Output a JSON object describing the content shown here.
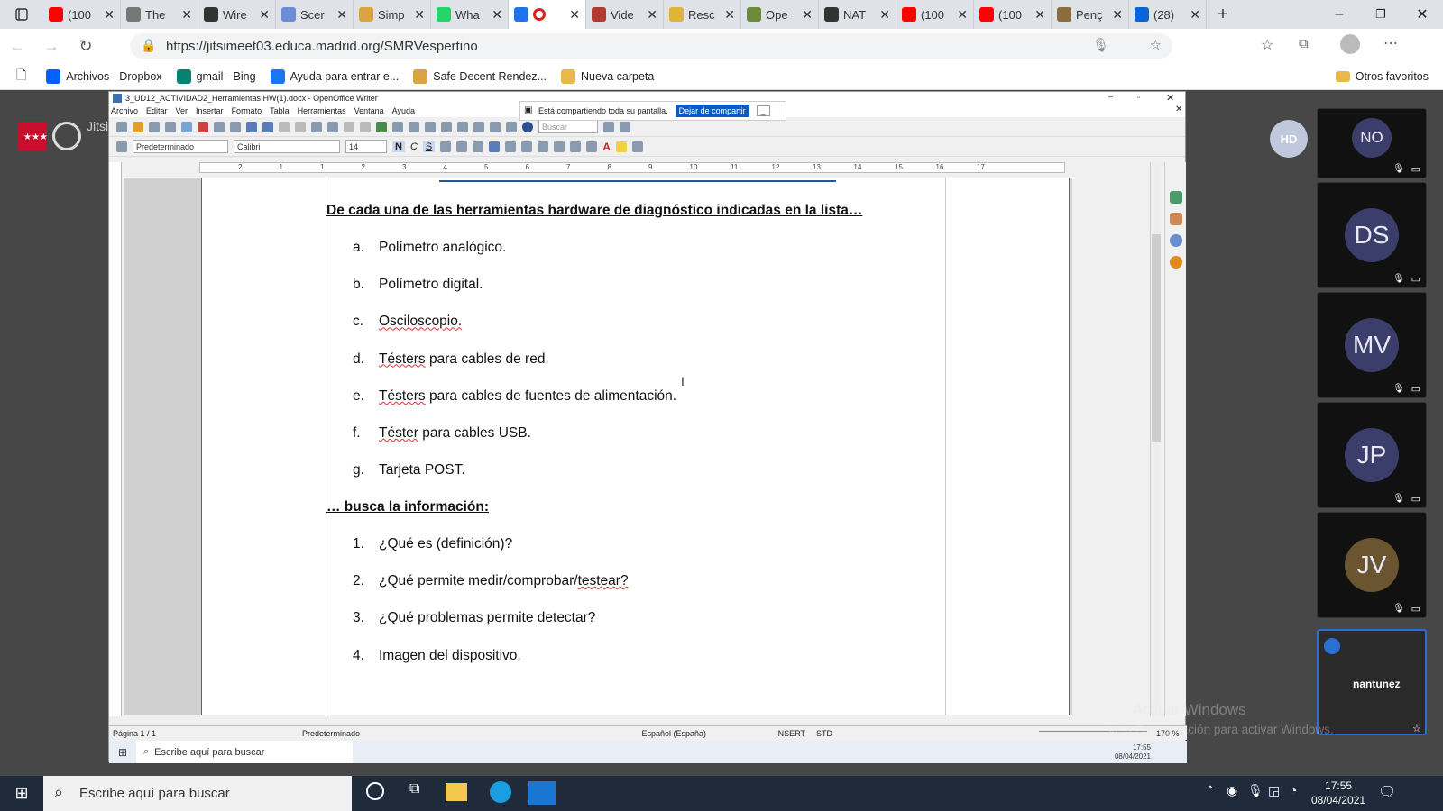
{
  "browser": {
    "tabs": [
      {
        "title": "(100",
        "icon": "youtube-icon",
        "color": "#ff0000"
      },
      {
        "title": "The",
        "icon": "medium-icon",
        "color": "#777777"
      },
      {
        "title": "Wire",
        "icon": "github-icon",
        "color": "#333333"
      },
      {
        "title": "Scer",
        "icon": "globe-icon",
        "color": "#6b8dd6"
      },
      {
        "title": "Simp",
        "icon": "hand-icon",
        "color": "#d9a441"
      },
      {
        "title": "Wha",
        "icon": "whatsapp-icon",
        "color": "#25d366"
      },
      {
        "title": "",
        "icon": "jitsi-icon",
        "color": "#1e73e8",
        "active": true
      },
      {
        "title": "Vide",
        "icon": "video-icon",
        "color": "#b03a2e"
      },
      {
        "title": "Resc",
        "icon": "smiley-icon",
        "color": "#e2b33b"
      },
      {
        "title": "Ope",
        "icon": "image-icon",
        "color": "#6d8a3a"
      },
      {
        "title": "NAT",
        "icon": "github-icon",
        "color": "#333333"
      },
      {
        "title": "(100",
        "icon": "youtube-icon",
        "color": "#ff0000"
      },
      {
        "title": "(100",
        "icon": "youtube-icon",
        "color": "#ff0000"
      },
      {
        "title": "Penç",
        "icon": "box-icon",
        "color": "#8a6d3b"
      },
      {
        "title": "(28)",
        "icon": "mail-icon",
        "color": "#0a64d8"
      }
    ],
    "url": "https://jitsimeet03.educa.madrid.org/SMRVespertino",
    "favorites": [
      {
        "label": "Archivos - Dropbox",
        "icon": "dropbox-icon"
      },
      {
        "label": "gmail - Bing",
        "icon": "bing-icon"
      },
      {
        "label": "Ayuda para entrar e...",
        "icon": "facebook-icon"
      },
      {
        "label": "Safe Decent Rendez...",
        "icon": "hand-icon"
      },
      {
        "label": "Nueva carpeta",
        "icon": "folder-icon"
      }
    ],
    "other_favorites": "Otros favoritos"
  },
  "writer": {
    "window_title": "3_UD12_ACTIVIDAD2_Herramientas HW(1).docx - OpenOffice Writer",
    "menu": [
      "Archivo",
      "Editar",
      "Ver",
      "Insertar",
      "Formato",
      "Tabla",
      "Herramientas",
      "Ventana",
      "Ayuda"
    ],
    "share_text": "Está compartiendo toda su pantalla.",
    "share_button": "Dejar de compartir",
    "style_combo": "Predeterminado",
    "font_combo": "Calibri",
    "size_combo": "14",
    "search_placeholder": "Buscar",
    "ruler_numbers": [
      "2",
      "1",
      "1",
      "2",
      "3",
      "4",
      "5",
      "6",
      "7",
      "8",
      "9",
      "10",
      "11",
      "12",
      "13",
      "14",
      "15",
      "16",
      "17"
    ],
    "document": {
      "heading1": "De cada una de las herramientas hardware de diagnóstico indicadas en la lista…",
      "list1": [
        {
          "marker": "a.",
          "text": "Polímetro analógico."
        },
        {
          "marker": "b.",
          "text": "Polímetro digital."
        },
        {
          "marker": "c.",
          "text": "Osciloscopio."
        },
        {
          "marker": "d.",
          "text": "Tésters para cables de red."
        },
        {
          "marker": "e.",
          "text": "Tésters para cables de fuentes de alimentación."
        },
        {
          "marker": "f.",
          "text": "Téster para cables USB."
        },
        {
          "marker": "g.",
          "text": "Tarjeta POST."
        }
      ],
      "heading2": "… busca la información:",
      "list2": [
        {
          "marker": "1.",
          "text": "¿Qué es (definición)?"
        },
        {
          "marker": "2.",
          "text": "¿Qué permite medir/comprobar/testear?"
        },
        {
          "marker": "3.",
          "text": "¿Qué problemas permite detectar?"
        },
        {
          "marker": "4.",
          "text": "Imagen del dispositivo."
        }
      ]
    },
    "status": {
      "page": "Página 1 / 1",
      "style": "Predeterminado",
      "language": "Español (España)",
      "mode": "INSERT",
      "selection": "STD",
      "zoom": "170 %"
    },
    "inner_taskbar": {
      "search": "Escribe aquí para buscar",
      "time": "17:55",
      "date": "08/04/2021"
    }
  },
  "jitsi": {
    "brand": "Jitsi",
    "local_avatar": "HD",
    "participants": [
      {
        "initials": "NO",
        "color": "#3b3d6b"
      },
      {
        "initials": "DS",
        "color": "#3b3d6b"
      },
      {
        "initials": "MV",
        "color": "#3b3d6b"
      },
      {
        "initials": "JP",
        "color": "#3b3d6b"
      },
      {
        "initials": "JV",
        "color": "#6b5430"
      }
    ],
    "screen_share_name": "nantunez"
  },
  "watermark": {
    "line1": "Activar Windows",
    "line2": "Ve a Configuración para activar Windows."
  },
  "taskbar": {
    "search": "Escribe aquí para buscar",
    "time": "17:55",
    "date": "08/04/2021"
  }
}
